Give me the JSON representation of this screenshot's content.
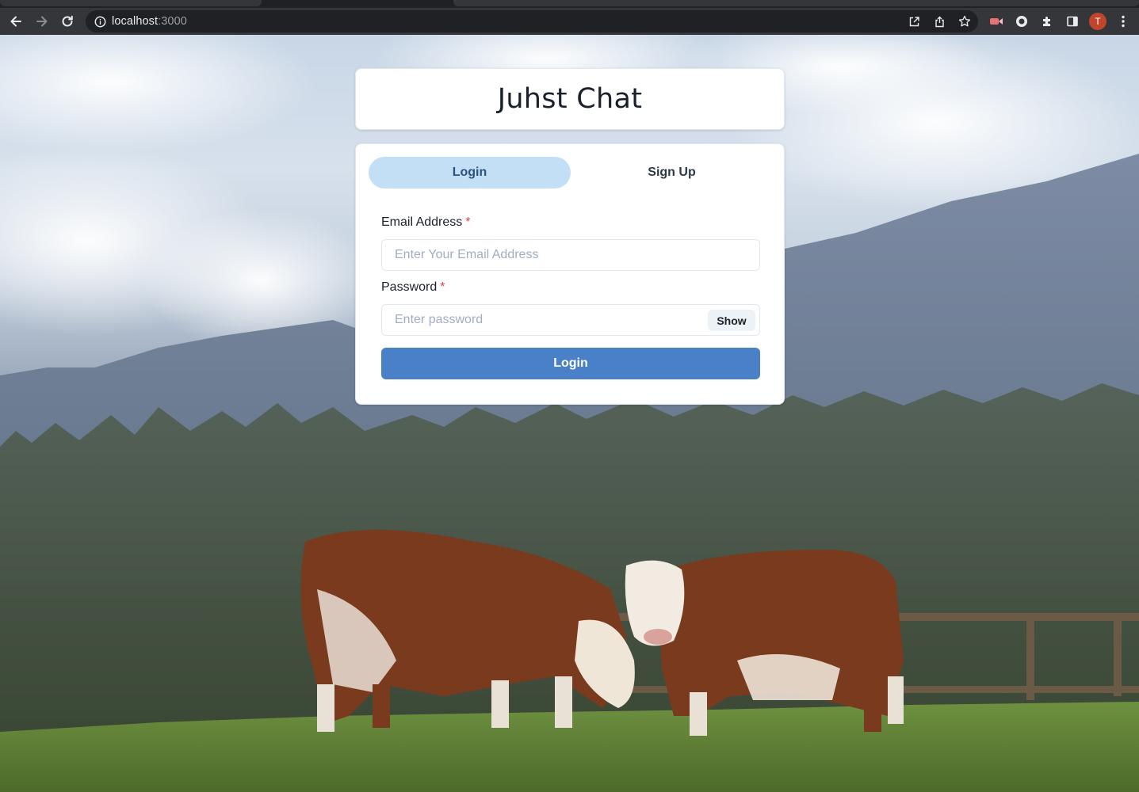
{
  "browser": {
    "url_host": "localhost",
    "url_port": ":3000",
    "profile_initial": "T"
  },
  "app": {
    "title": "Juhst Chat"
  },
  "tabs": [
    {
      "label": "Login",
      "active": true
    },
    {
      "label": "Sign Up",
      "active": false
    }
  ],
  "form": {
    "email_label": "Email Address",
    "email_required": "*",
    "email_placeholder": "Enter Your Email Address",
    "password_label": "Password",
    "password_required": "*",
    "password_placeholder": "Enter password",
    "show_label": "Show",
    "submit_label": "Login"
  },
  "colors": {
    "active_tab_bg": "#c3dff5",
    "primary_button": "#4a80c8",
    "required_star": "#e53e3e"
  }
}
